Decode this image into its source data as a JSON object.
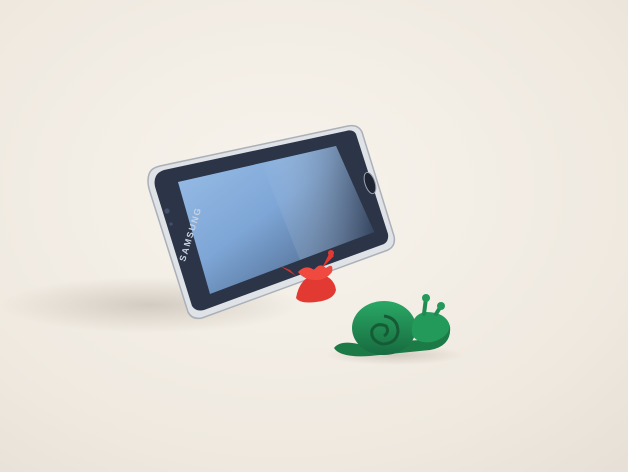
{
  "photo": {
    "phone": {
      "brand_text": "SAMSUNG"
    },
    "stand_color": "#e6322d",
    "snail_color": "#1f8a52",
    "background_color": "#f2ede5",
    "phone_body_color": "#4a5a7a",
    "phone_screen_color": "#7fa6d6",
    "phone_rim_color": "#d9dce0"
  }
}
